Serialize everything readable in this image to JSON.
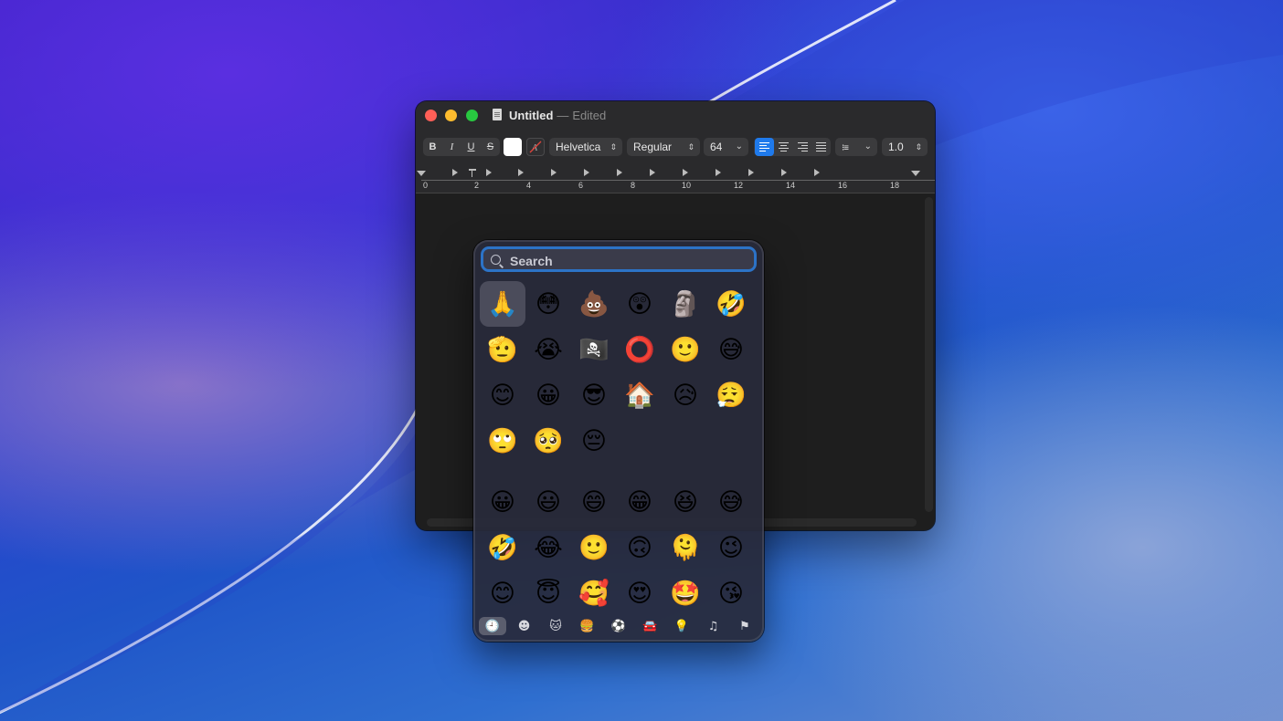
{
  "window": {
    "title": "Untitled",
    "separator": "—",
    "status": "Edited"
  },
  "toolbar": {
    "bold_label": "B",
    "italic_label": "I",
    "underline_label": "U",
    "strike_label": "S",
    "font_family": "Helvetica",
    "font_style": "Regular",
    "font_size": "64",
    "line_spacing": "1.0",
    "text_color": "#ffffff",
    "highlight_color": "#2a2a2c",
    "accent_color": "#1f7aec"
  },
  "ruler": {
    "numbers": [
      "0",
      "2",
      "4",
      "6",
      "8",
      "10",
      "12",
      "14",
      "16",
      "18"
    ]
  },
  "emoji_picker": {
    "search_placeholder": "Search",
    "recent": [
      "🙏",
      "😳",
      "💩",
      "😲",
      "🗿",
      "🤣",
      "🫡",
      "😭",
      "🏴‍☠️",
      "⭕",
      "🙂",
      "😅",
      "😊",
      "😀",
      "😎",
      "🏠",
      "😥",
      "😮‍💨",
      "🙄",
      "🥺",
      "😔"
    ],
    "smileys": [
      "😀",
      "😃",
      "😄",
      "😁",
      "😆",
      "😅",
      "🤣",
      "😂",
      "🙂",
      "🙃",
      "🫠",
      "😉",
      "😊",
      "😇",
      "🥰",
      "😍",
      "🤩",
      "😘"
    ],
    "categories": [
      {
        "name": "recent-icon",
        "glyph": "🕘"
      },
      {
        "name": "smileys-icon",
        "glyph": "☻"
      },
      {
        "name": "animals-icon",
        "glyph": "🐱"
      },
      {
        "name": "food-icon",
        "glyph": "🍔"
      },
      {
        "name": "activity-icon",
        "glyph": "⚽"
      },
      {
        "name": "travel-icon",
        "glyph": "🚘"
      },
      {
        "name": "objects-icon",
        "glyph": "💡"
      },
      {
        "name": "symbols-icon",
        "glyph": "♫"
      },
      {
        "name": "flags-icon",
        "glyph": "⚑"
      }
    ]
  }
}
